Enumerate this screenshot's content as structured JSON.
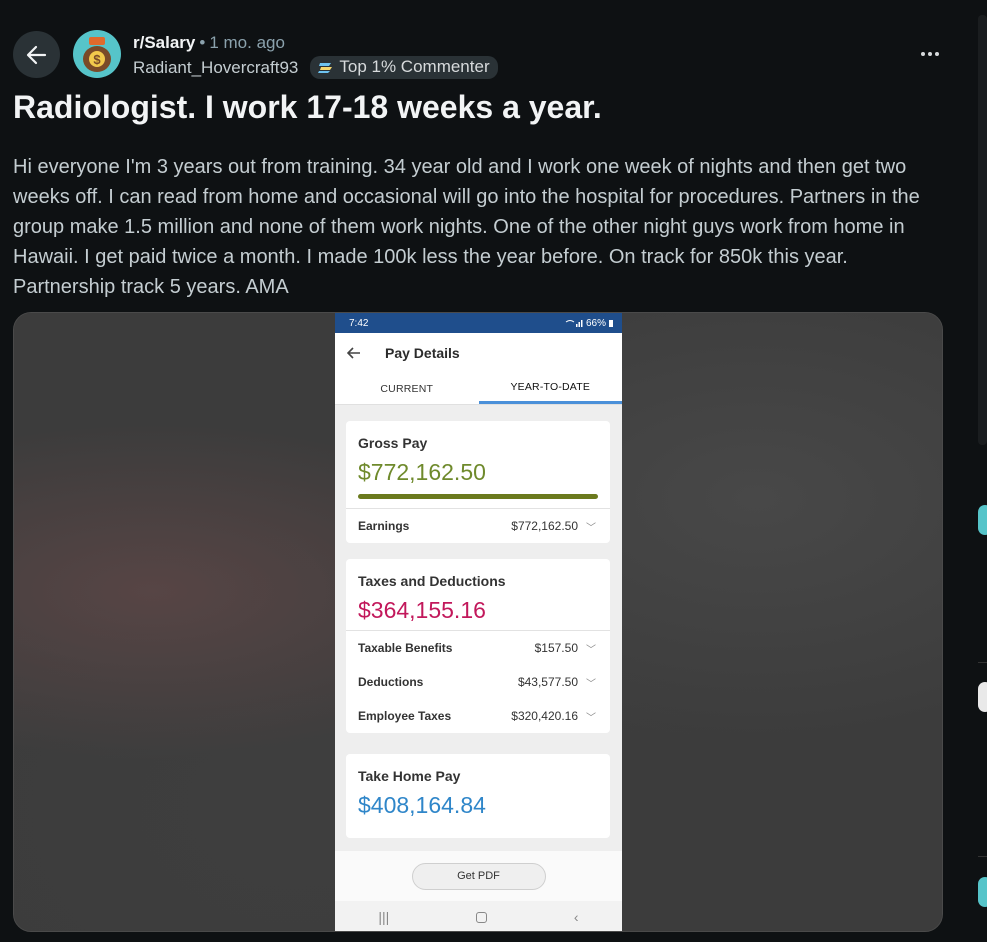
{
  "post": {
    "subreddit": "r/Salary",
    "separator": "•",
    "time": "1 mo. ago",
    "username": "Radiant_Hovercraft93",
    "flair": "Top 1% Commenter",
    "title": "Radiologist. I work 17-18 weeks a year.",
    "body": "Hi everyone I'm 3 years out from training. 34 year old and I work one week of nights and then get two weeks off. I can read from home and occasional will go into the hospital for procedures. Partners in the group make 1.5 million and none of them work nights. One of the other night guys work from home in Hawaii. I get paid twice a month. I made 100k less the year before. On track for 850k this year. Partnership track 5 years. AMA"
  },
  "phone": {
    "status": {
      "time": "7:42",
      "battery": "66%"
    },
    "app_title": "Pay Details",
    "tabs": [
      "CURRENT",
      "YEAR-TO-DATE"
    ],
    "active_tab": "YEAR-TO-DATE",
    "gross": {
      "label": "Gross Pay",
      "amount": "$772,162.50",
      "progress": 1.0,
      "rows": [
        {
          "label": "Earnings",
          "value": "$772,162.50"
        }
      ]
    },
    "taxes": {
      "label": "Taxes and Deductions",
      "amount": "$364,155.16",
      "rows": [
        {
          "label": "Taxable Benefits",
          "value": "$157.50"
        },
        {
          "label": "Deductions",
          "value": "$43,577.50"
        },
        {
          "label": "Employee Taxes",
          "value": "$320,420.16"
        }
      ]
    },
    "take_home": {
      "label": "Take Home Pay",
      "amount": "$408,164.84"
    },
    "pdf_button": "Get PDF"
  },
  "colors": {
    "background": "#0e1113",
    "gross": "#6f8a2c",
    "taxes": "#c2185b",
    "take_home": "#2f86c9",
    "phone_status": "#1f4e8c"
  }
}
